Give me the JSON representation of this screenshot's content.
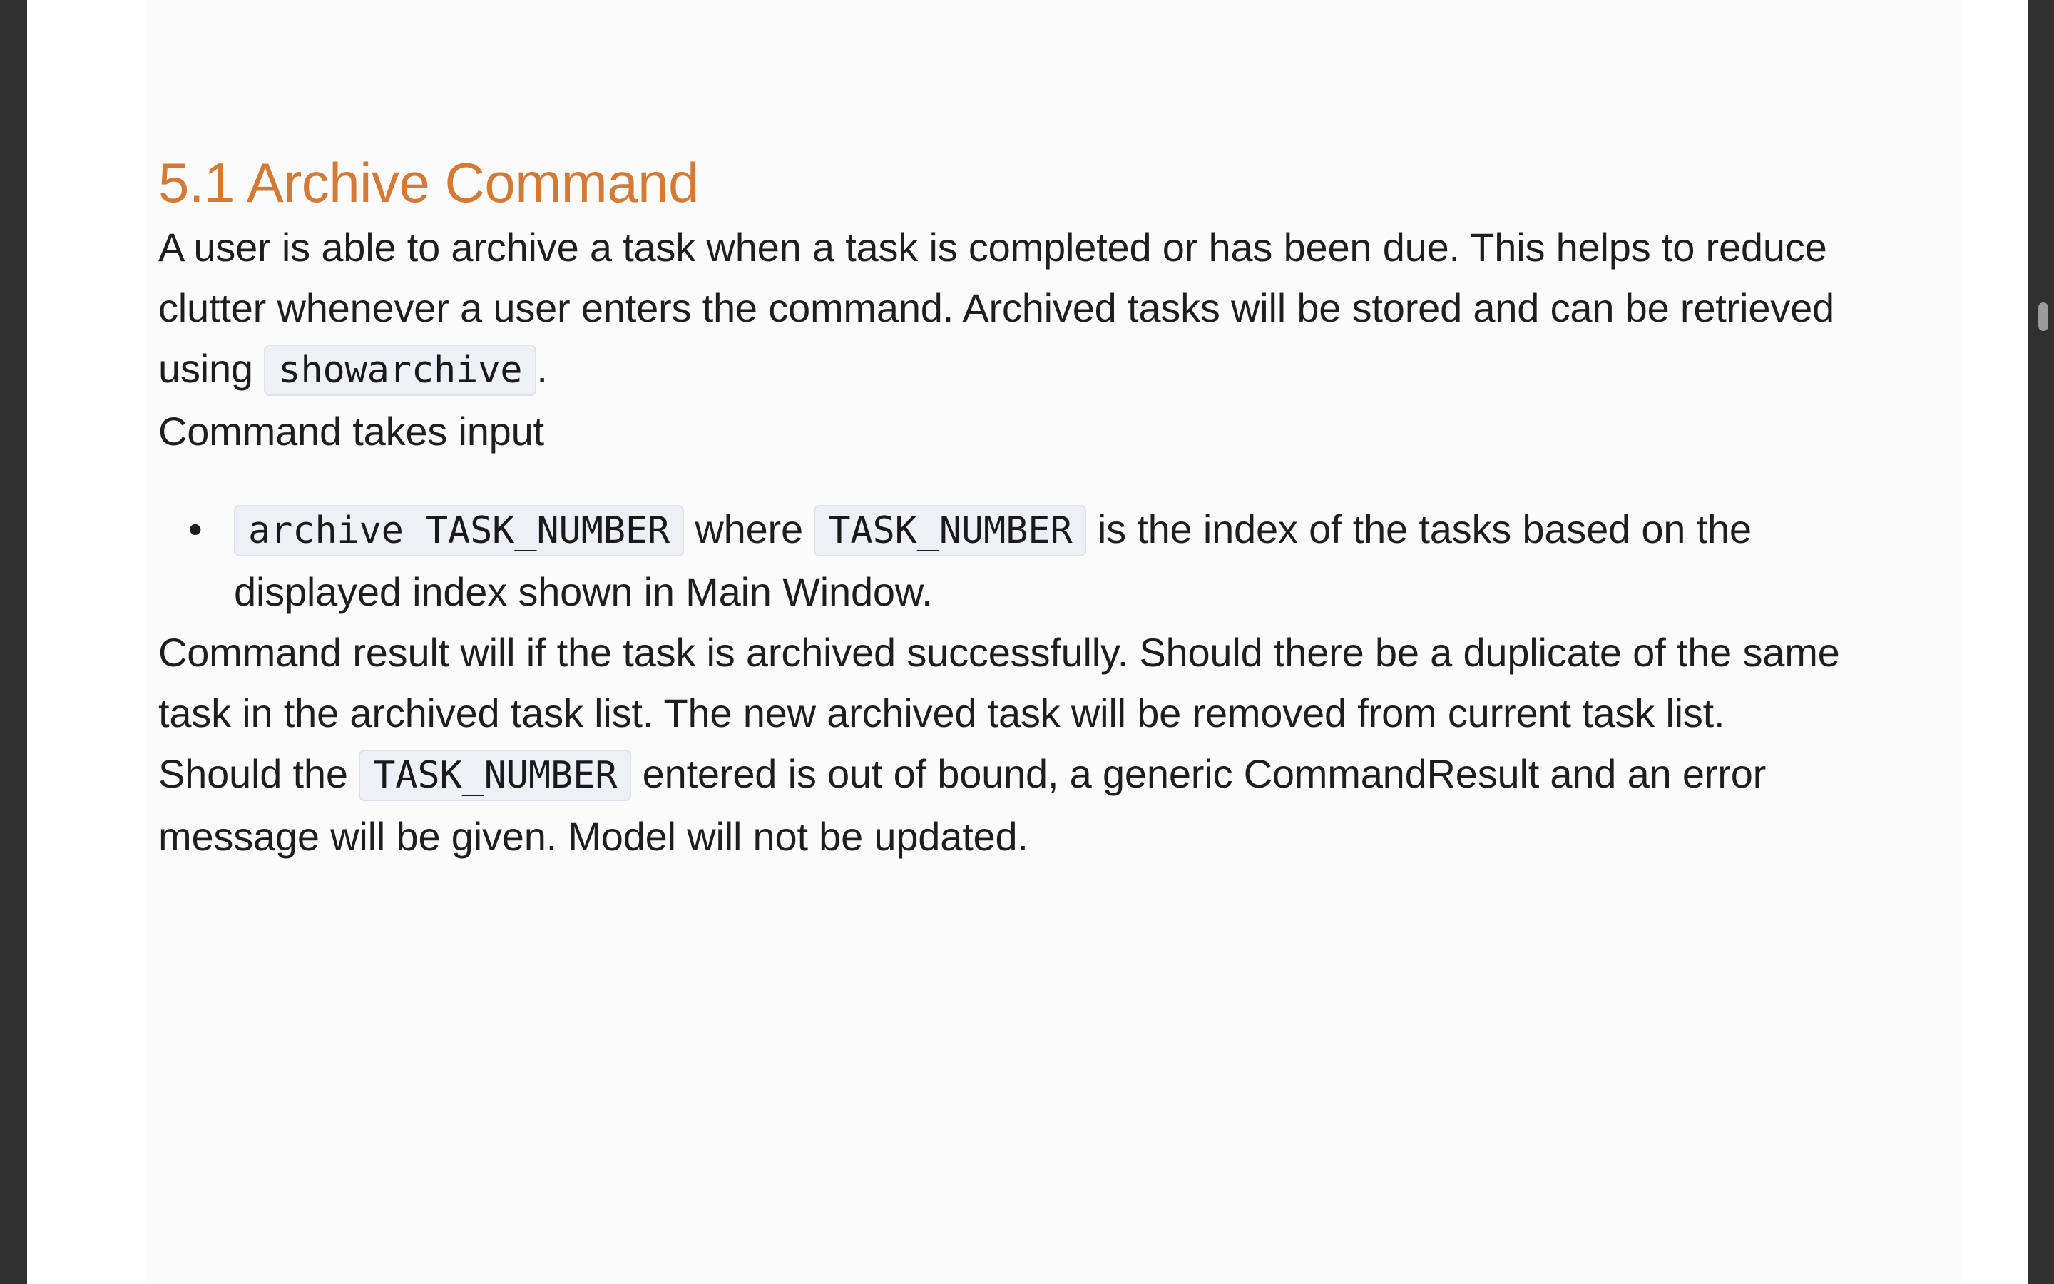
{
  "section": {
    "title": "5.1 Archive Command"
  },
  "para1": {
    "text_before": "A user is able to archive a task when a task is completed or has been due. This helps to reduce clutter whenever a user enters the command. Archived tasks will be stored and can be retrieved using ",
    "code": "showarchive",
    "text_after": "."
  },
  "para2": {
    "text": "Command takes input"
  },
  "input_list": {
    "item1": {
      "code1": "archive TASK_NUMBER",
      "text1": " where ",
      "code2": "TASK_NUMBER",
      "text2": " is the index of the tasks based on the displayed index shown in Main Window."
    }
  },
  "para3": {
    "text": "Command result will if the task is archived successfully. Should there be a duplicate of the same task in the archived task list. The new archived task will be removed from current task list."
  },
  "para4": {
    "text_before": "Should the ",
    "code": "TASK_NUMBER",
    "text_after": " entered is out of bound, a generic CommandResult and an error message will be given. Model will not be updated."
  },
  "colors": {
    "heading": "#d27a36",
    "text": "#1e1e1e",
    "code_bg": "#efeff8",
    "page_bg": "#fbfbfb",
    "frame_bg": "#303030"
  }
}
